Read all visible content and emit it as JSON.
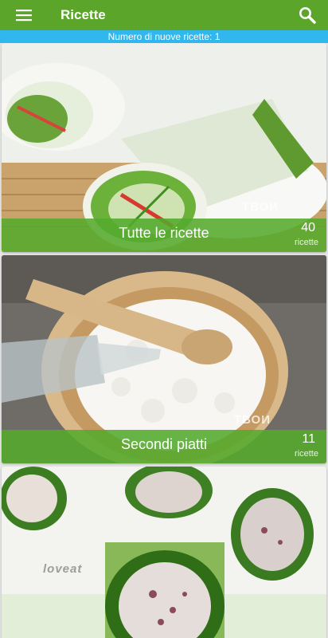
{
  "app": {
    "title": "Ricette"
  },
  "icons": {
    "menu": "hamburger-menu-icon",
    "search": "search-icon"
  },
  "banner": {
    "text": "Numero di nuove ricette: 1"
  },
  "categories": [
    {
      "name": "Tutte le ricette",
      "count": "40",
      "unit": "ricette",
      "watermark": "ТВОИ"
    },
    {
      "name": "Secondi piatti",
      "count": "11",
      "unit": "ricette",
      "watermark": "ТВОИ"
    },
    {
      "name": "",
      "count": "",
      "unit": "",
      "watermark": "loveat"
    }
  ],
  "colors": {
    "appbar": "#5aa52a",
    "banner": "#2fb7ee",
    "caption": "#54aa2c"
  }
}
